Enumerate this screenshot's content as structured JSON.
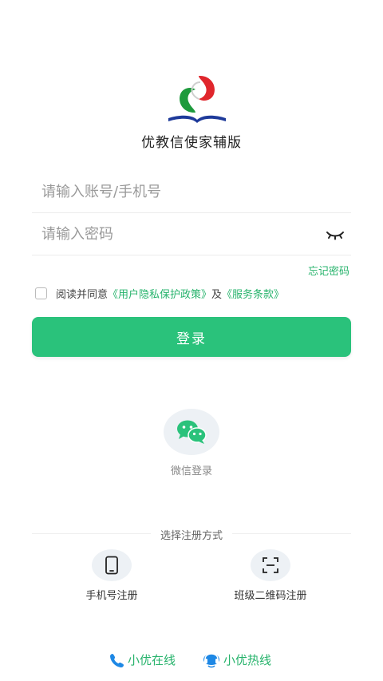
{
  "app": {
    "title": "优教信使家辅版"
  },
  "login": {
    "account_placeholder": "请输入账号/手机号",
    "password_placeholder": "请输入密码",
    "forgot_label": "忘记密码",
    "agree_prefix": "阅读并同意",
    "privacy_link": "《用户隐私保护政策》",
    "and_text": "及",
    "terms_link": "《服务条款》",
    "submit_label": "登录"
  },
  "wechat": {
    "label": "微信登录"
  },
  "register": {
    "divider_label": "选择注册方式",
    "phone_label": "手机号注册",
    "qr_label": "班级二维码注册"
  },
  "footer": {
    "online_label": "小优在线",
    "hotline_label": "小优热线"
  },
  "colors": {
    "accent": "#2ac27b",
    "link": "#27b36c",
    "icon_bg": "#edf1f5"
  },
  "icons": {
    "logo": "app-logo",
    "password_toggle": "eye-closed-icon",
    "wechat": "wechat-icon",
    "phone": "mobile-phone-icon",
    "qr": "qr-scan-icon",
    "online": "phone-icon",
    "hotline": "headset-icon"
  }
}
